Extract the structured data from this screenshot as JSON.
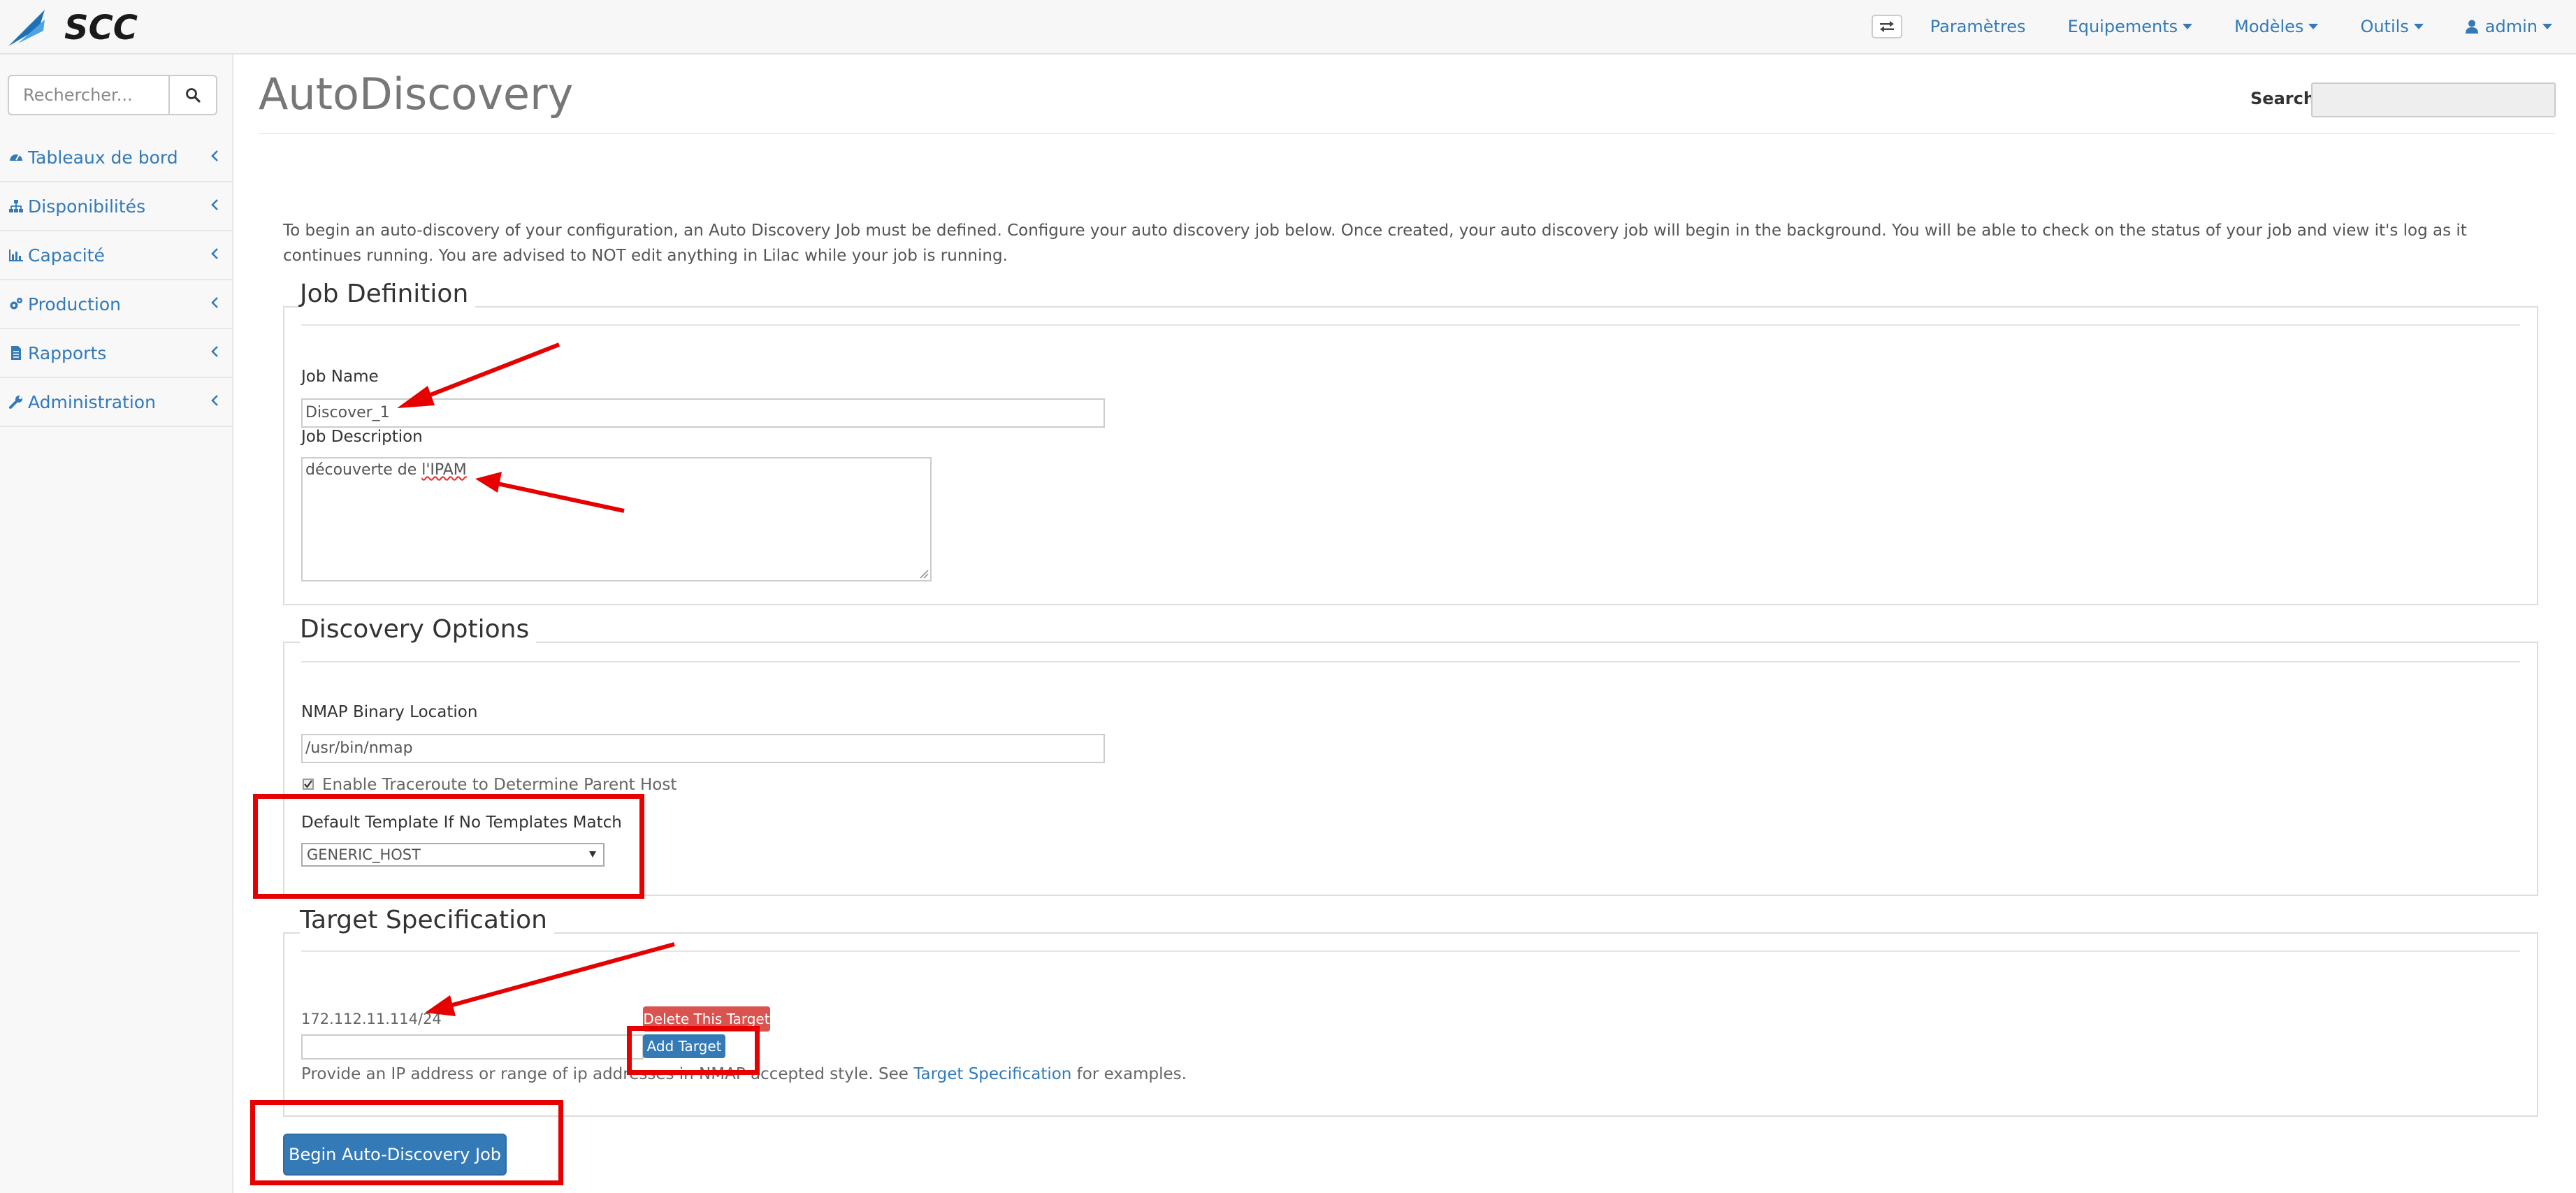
{
  "app": {
    "logo_text": "SCC"
  },
  "navbar": {
    "items": [
      {
        "label": "Paramètres",
        "dropdown": false
      },
      {
        "label": "Equipements",
        "dropdown": true
      },
      {
        "label": "Modèles",
        "dropdown": true
      },
      {
        "label": "Outils",
        "dropdown": true
      },
      {
        "label": "admin",
        "dropdown": true
      }
    ]
  },
  "sidebar": {
    "search_placeholder": "Rechercher...",
    "items": [
      {
        "label": "Tableaux de bord",
        "icon": "dashboard-icon"
      },
      {
        "label": "Disponibilités",
        "icon": "sitemap-icon"
      },
      {
        "label": "Capacité",
        "icon": "bar-chart-icon"
      },
      {
        "label": "Production",
        "icon": "cogs-icon"
      },
      {
        "label": "Rapports",
        "icon": "document-icon"
      },
      {
        "label": "Administration",
        "icon": "wrench-icon"
      }
    ]
  },
  "page": {
    "title": "AutoDiscovery",
    "search_label": "Search:",
    "intro": "To begin an auto-discovery of your configuration, an Auto Discovery Job must be defined. Configure your auto discovery job below. Once created, your auto discovery job will begin in the background. You will be able to check on the status of your job and view it's log as it continues running. You are advised to NOT edit anything in Lilac while your job is running."
  },
  "job_definition": {
    "legend": "Job Definition",
    "name_label": "Job Name",
    "name_value": "Discover_1",
    "description_label": "Job Description",
    "description_prefix": "découverte de ",
    "description_spell": "l'IPAM"
  },
  "discovery_options": {
    "legend": "Discovery Options",
    "nmap_label": "NMAP Binary Location",
    "nmap_value": "/usr/bin/nmap",
    "traceroute_label": "Enable Traceroute to Determine Parent Host",
    "traceroute_checked": true,
    "template_label": "Default Template If No Templates Match",
    "template_value": "GENERIC_HOST"
  },
  "target_specification": {
    "legend": "Target Specification",
    "target_value": "172.112.11.114/24",
    "delete_label": "Delete This Target",
    "add_label": "Add Target",
    "help_prefix": "Provide an IP address or range of ip addresses in NMAP accepted style. See ",
    "help_link": "Target Specification",
    "help_suffix": " for examples."
  },
  "actions": {
    "begin_label": "Begin Auto-Discovery Job"
  },
  "colors": {
    "link": "#337ab7",
    "danger": "#d9534f",
    "annotation": "#e60000"
  }
}
